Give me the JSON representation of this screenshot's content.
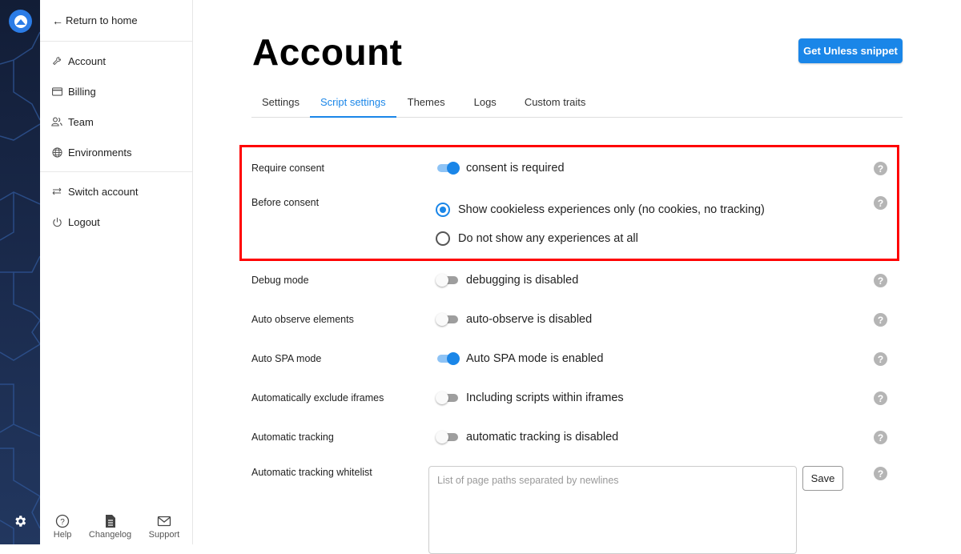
{
  "sidebar": {
    "back_label": "Return to home",
    "nav": [
      {
        "label": "Account",
        "icon": "wrench-icon"
      },
      {
        "label": "Billing",
        "icon": "credit-card-icon"
      },
      {
        "label": "Team",
        "icon": "users-icon"
      },
      {
        "label": "Environments",
        "icon": "globe-icon"
      }
    ],
    "nav2": [
      {
        "label": "Switch account",
        "icon": "swap-icon"
      },
      {
        "label": "Logout",
        "icon": "power-icon"
      }
    ],
    "footer": [
      {
        "label": "Help",
        "icon": "help-circle-icon"
      },
      {
        "label": "Changelog",
        "icon": "document-icon"
      },
      {
        "label": "Support",
        "icon": "mail-icon"
      }
    ]
  },
  "header": {
    "title": "Account",
    "snippet_button": "Get Unless snippet"
  },
  "tabs": [
    {
      "label": "Settings",
      "active": false
    },
    {
      "label": "Script settings",
      "active": true
    },
    {
      "label": "Themes",
      "active": false
    },
    {
      "label": "Logs",
      "active": false
    },
    {
      "label": "Custom traits",
      "active": false
    }
  ],
  "settings": {
    "require_consent": {
      "label": "Require consent",
      "state_text": "consent is required",
      "enabled": true
    },
    "before_consent": {
      "label": "Before consent",
      "options": [
        {
          "label": "Show cookieless experiences only (no cookies, no tracking)",
          "selected": true
        },
        {
          "label": "Do not show any experiences at all",
          "selected": false
        }
      ]
    },
    "debug_mode": {
      "label": "Debug mode",
      "state_text": "debugging is disabled",
      "enabled": false
    },
    "auto_observe": {
      "label": "Auto observe elements",
      "state_text": "auto-observe is disabled",
      "enabled": false
    },
    "auto_spa": {
      "label": "Auto SPA mode",
      "state_text": "Auto SPA mode is enabled",
      "enabled": true
    },
    "exclude_iframes": {
      "label": "Automatically exclude iframes",
      "state_text": "Including scripts within iframes",
      "enabled": false
    },
    "auto_tracking": {
      "label": "Automatic tracking",
      "state_text": "automatic tracking is disabled",
      "enabled": false
    },
    "whitelist": {
      "label": "Automatic tracking whitelist",
      "placeholder": "List of page paths separated by newlines",
      "value": "",
      "save_label": "Save"
    }
  },
  "help_glyph": "?",
  "colors": {
    "accent": "#1a86e8",
    "highlight": "#ff0000",
    "rail": "#1a2a4c"
  }
}
